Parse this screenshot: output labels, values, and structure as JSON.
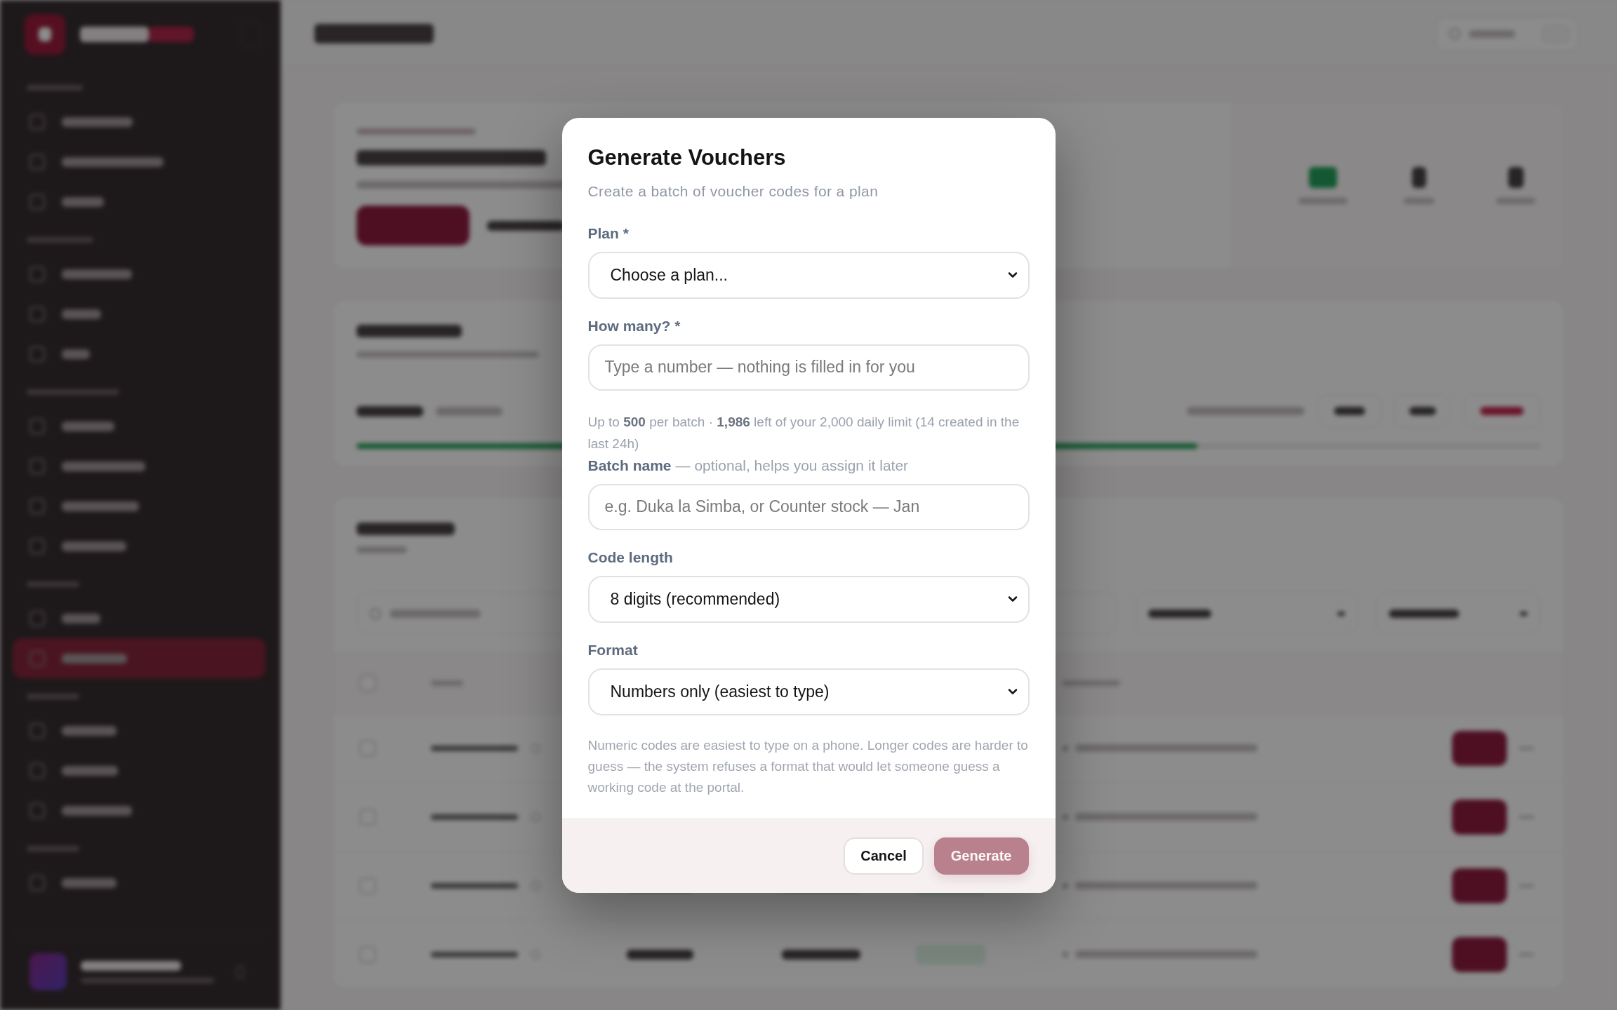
{
  "modal": {
    "title": "Generate Vouchers",
    "subtitle": "Create a batch of voucher codes for a plan",
    "fields": [
      {
        "kind": "select",
        "label": "Plan *",
        "value": "Choose a plan..."
      },
      {
        "kind": "input",
        "label": "How many? *",
        "placeholder": "Type a number — nothing is filled in for you",
        "hint": "Up to **500** per batch · **1,986** left of your 2,000 daily limit (14 created in the last 24h)"
      },
      {
        "kind": "input",
        "label": "Batch name",
        "label_note": "— optional, helps you assign it later",
        "placeholder": "e.g. Duka la Simba, or Counter stock — Jan"
      },
      {
        "kind": "select",
        "label": "Code length",
        "value": "8 digits (recommended)"
      },
      {
        "kind": "select",
        "label": "Format",
        "value": "Numbers only (easiest to type)"
      }
    ],
    "note": "Numeric codes are easiest to type on a phone. Longer codes are harder to guess — the system refuses a format that would let someone guess a working code at the portal.",
    "buttons": [
      {
        "label": "Cancel",
        "kind": "secondary",
        "disabled": false
      },
      {
        "label": "Generate",
        "kind": "primary",
        "disabled": true
      }
    ]
  }
}
